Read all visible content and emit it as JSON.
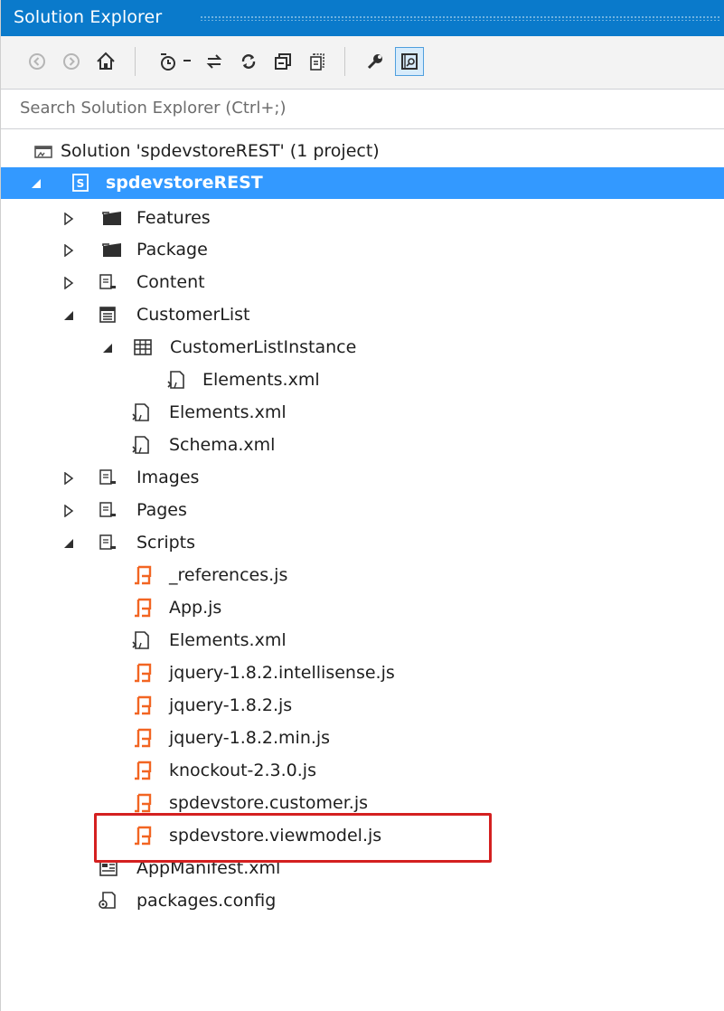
{
  "panel": {
    "title": "Solution Explorer",
    "search_placeholder": "Search Solution Explorer (Ctrl+;)"
  },
  "toolbar": {
    "buttons": [
      "back-icon",
      "forward-icon",
      "home-icon",
      "pending-changes-icon",
      "dropdown-icon",
      "sync-icon",
      "refresh-icon",
      "collapse-all-icon",
      "show-all-files-icon",
      "properties-icon",
      "preview-selected-icon"
    ]
  },
  "tree": {
    "solution": "Solution 'spdevstoreREST' (1 project)",
    "project": "spdevstoreREST",
    "items": [
      "Features",
      "Package",
      "Content",
      "CustomerList",
      "CustomerListInstance",
      "Elements.xml",
      "Elements.xml",
      "Schema.xml",
      "Images",
      "Pages",
      "Scripts",
      "_references.js",
      "App.js",
      "Elements.xml",
      "jquery-1.8.2.intellisense.js",
      "jquery-1.8.2.js",
      "jquery-1.8.2.min.js",
      "knockout-2.3.0.js",
      "spdevstore.customer.js",
      "spdevstore.viewmodel.js",
      "AppManifest.xml",
      "packages.config"
    ]
  },
  "colors": {
    "titlebar": "#0a7acb",
    "selection": "#3399ff",
    "highlight_box": "#d42020",
    "js_icon": "#f26522"
  }
}
